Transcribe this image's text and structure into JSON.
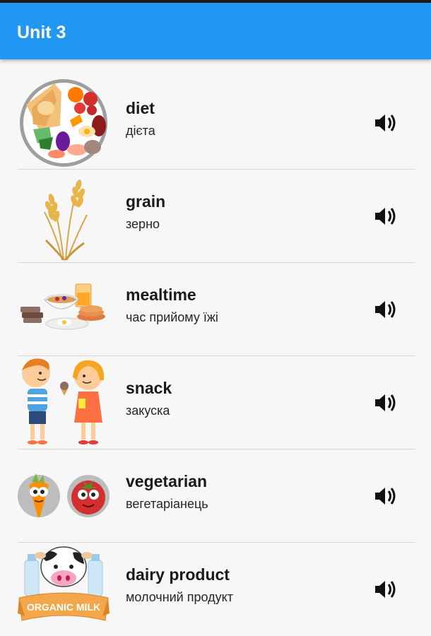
{
  "app_bar": {
    "title": "Unit 3",
    "color": "#2196f3"
  },
  "items": [
    {
      "word": "diet",
      "translation": "дієта",
      "image": "food-plate-image",
      "audio_icon": "speaker-icon"
    },
    {
      "word": "grain",
      "translation": "зерно",
      "image": "wheat-image",
      "audio_icon": "speaker-icon"
    },
    {
      "word": "mealtime",
      "translation": "час прийому їжі",
      "image": "breakfast-image",
      "audio_icon": "speaker-icon"
    },
    {
      "word": "snack",
      "translation": "закуска",
      "image": "kids-snack-image",
      "audio_icon": "speaker-icon"
    },
    {
      "word": "vegetarian",
      "translation": "вегетаріанець",
      "image": "carrot-tomato-image",
      "audio_icon": "speaker-icon"
    },
    {
      "word": "dairy product",
      "translation": "молочний продукт",
      "image": "organic-milk-image",
      "audio_icon": "speaker-icon",
      "image_text": "ORGANIC MILK"
    }
  ]
}
